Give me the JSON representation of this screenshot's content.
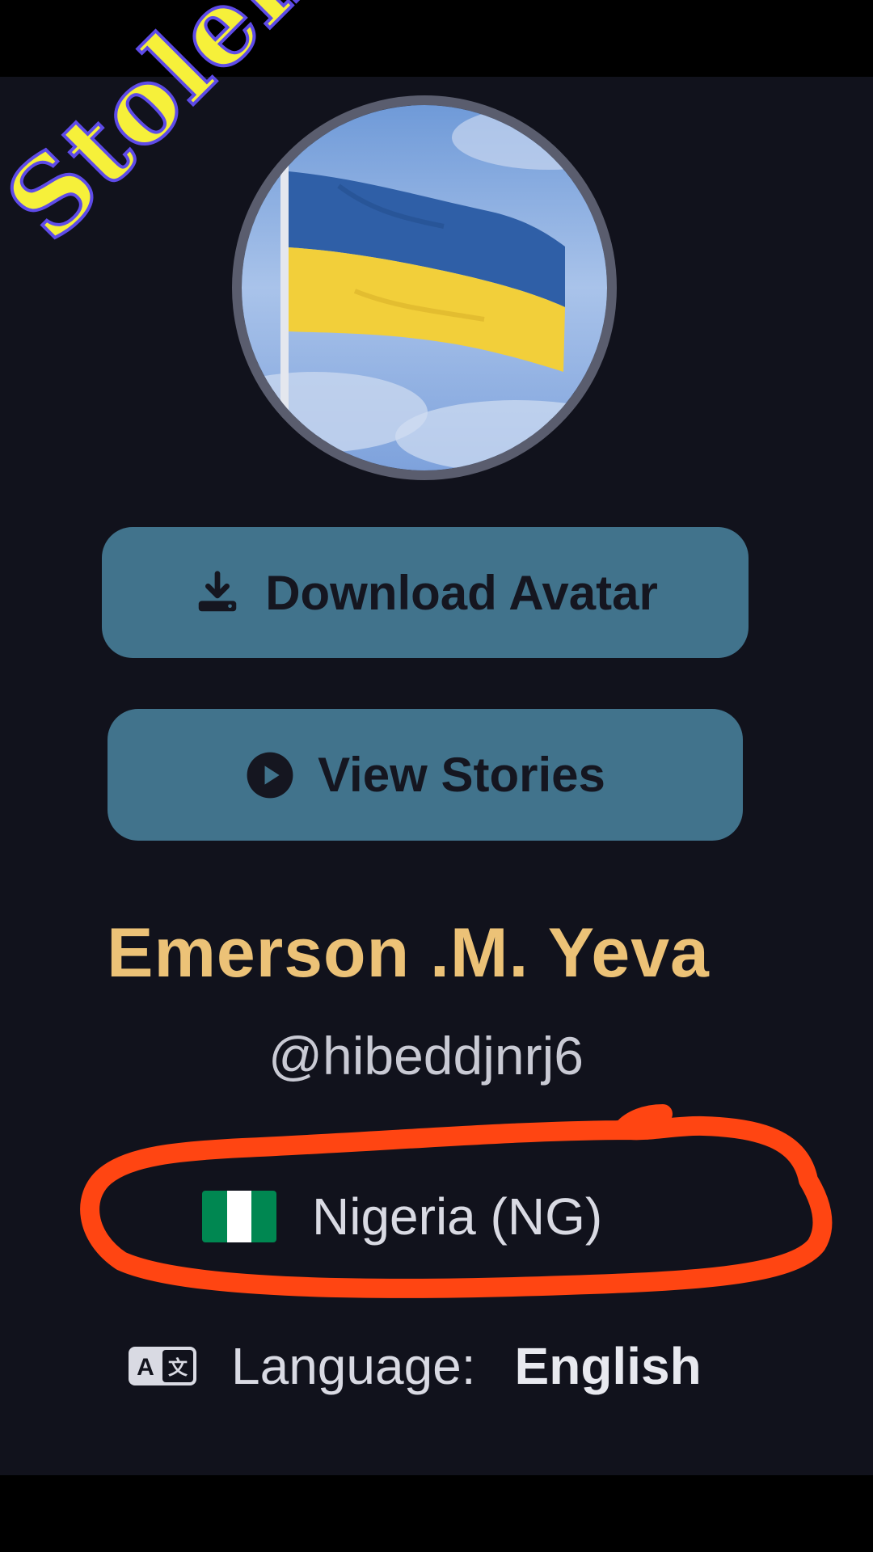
{
  "profile": {
    "avatar_alt": "Ukrainian flag",
    "watermark": "Stolen",
    "name": "Emerson .M. Yeva",
    "handle": "@hibeddjnrj6",
    "country": "Nigeria (NG)",
    "language_label": "Language:",
    "language_value": "English"
  },
  "actions": {
    "download_label": "Download Avatar",
    "stories_label": "View Stories"
  },
  "icons": {
    "download": "download-icon",
    "play": "play-circle-icon",
    "flag": "nigeria-flag-icon",
    "language": "translate-icon"
  },
  "colors": {
    "background": "#11121c",
    "button": "#41738c",
    "name": "#ecc277",
    "annotation": "#ff4512",
    "watermark_fill": "#f6f03a",
    "watermark_outline": "#5e4be8"
  }
}
